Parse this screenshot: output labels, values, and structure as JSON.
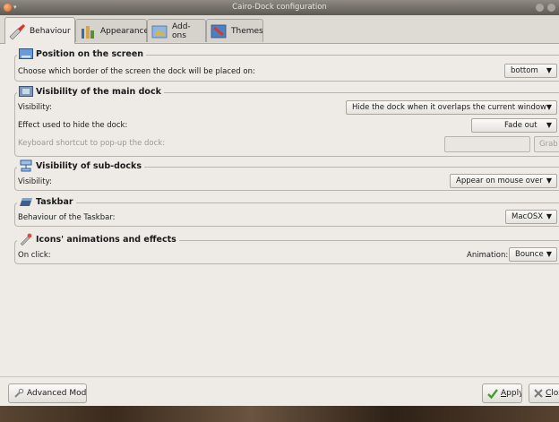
{
  "window": {
    "title": "Cairo-Dock configuration"
  },
  "tabs": [
    {
      "label": "Behaviour",
      "icon": "behaviour-icon",
      "active": true
    },
    {
      "label": "Appearance",
      "icon": "appearance-icon",
      "active": false
    },
    {
      "label": "Add-ons",
      "icon": "addons-icon",
      "active": false
    },
    {
      "label": "Themes",
      "icon": "themes-icon",
      "active": false
    }
  ],
  "sections": {
    "position": {
      "title": "Position on the screen",
      "border_label": "Choose which border of the screen the dock will be placed on:",
      "border_value": "bottom"
    },
    "visibility_main": {
      "title": "Visibility of the main dock",
      "visibility_label": "Visibility:",
      "visibility_value": "Hide the dock when it overlaps the current window",
      "effect_label": "Effect used to hide the dock:",
      "effect_value": "Fade out",
      "shortcut_label": "Keyboard shortcut to pop-up the dock:",
      "grab_label": "Grab"
    },
    "visibility_sub": {
      "title": "Visibility of sub-docks",
      "visibility_label": "Visibility:",
      "visibility_value": "Appear on mouse over"
    },
    "taskbar": {
      "title": "Taskbar",
      "behaviour_label": "Behaviour of the Taskbar:",
      "behaviour_value": "MacOSX"
    },
    "animations": {
      "title": "Icons' animations and effects",
      "onclick_label": "On click:",
      "animation_label": "Animation:",
      "animation_value": "Bounce"
    }
  },
  "buttons": {
    "advanced_mode": "Advanced Mode",
    "apply_mnemonic": "A",
    "apply_rest": "pply",
    "close_mnemonic": "C",
    "close_rest": "los"
  },
  "colors": {
    "accent": "#4a7fc1",
    "window_bg": "#eeebe6"
  }
}
